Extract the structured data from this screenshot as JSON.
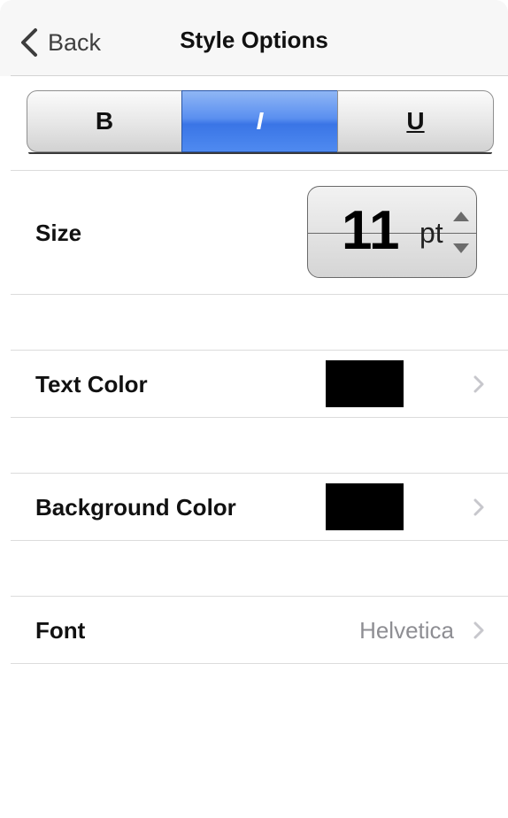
{
  "nav": {
    "back_label": "Back",
    "title": "Style Options"
  },
  "style_buttons": {
    "bold": "B",
    "italic": "I",
    "underline": "U",
    "selected": "italic"
  },
  "size": {
    "label": "Size",
    "value": "11",
    "unit": "pt"
  },
  "text_color": {
    "label": "Text Color",
    "color": "#000000"
  },
  "background_color": {
    "label": "Background Color",
    "color": "#000000"
  },
  "font": {
    "label": "Font",
    "value": "Helvetica"
  },
  "colors": {
    "accent": "#4f8af0",
    "secondary_text": "#8e8e93",
    "chevron": "#c7c7cc"
  }
}
